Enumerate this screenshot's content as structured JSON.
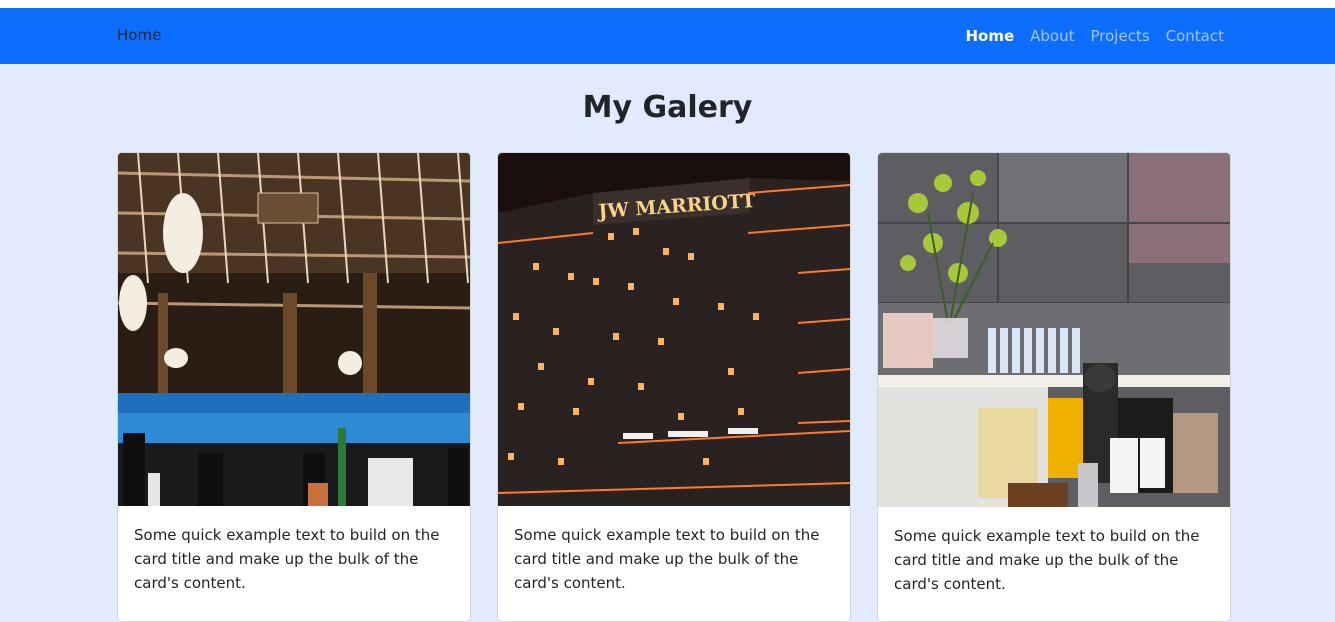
{
  "navbar": {
    "brand": "Home",
    "links": [
      {
        "label": "Home",
        "active": true
      },
      {
        "label": "About",
        "active": false
      },
      {
        "label": "Projects",
        "active": false
      },
      {
        "label": "Contact",
        "active": false
      }
    ]
  },
  "page": {
    "title": "My Galery"
  },
  "cards": [
    {
      "image": "night-pavilion-photo",
      "text": "Some quick example text to build on the card title and make up the bulk of the card's content."
    },
    {
      "image": "jw-marriott-hotel-photo",
      "image_sign": "JW MARRIOTT",
      "text": "Some quick example text to build on the card title and make up the bulk of the card's content."
    },
    {
      "image": "cafe-counter-photo",
      "text": "Some quick example text to build on the card title and make up the bulk of the card's content."
    }
  ],
  "colors": {
    "navbar_bg": "#0d6efd",
    "page_bg": "#e1ebfd",
    "card_bg": "#ffffff",
    "text": "#212529"
  }
}
